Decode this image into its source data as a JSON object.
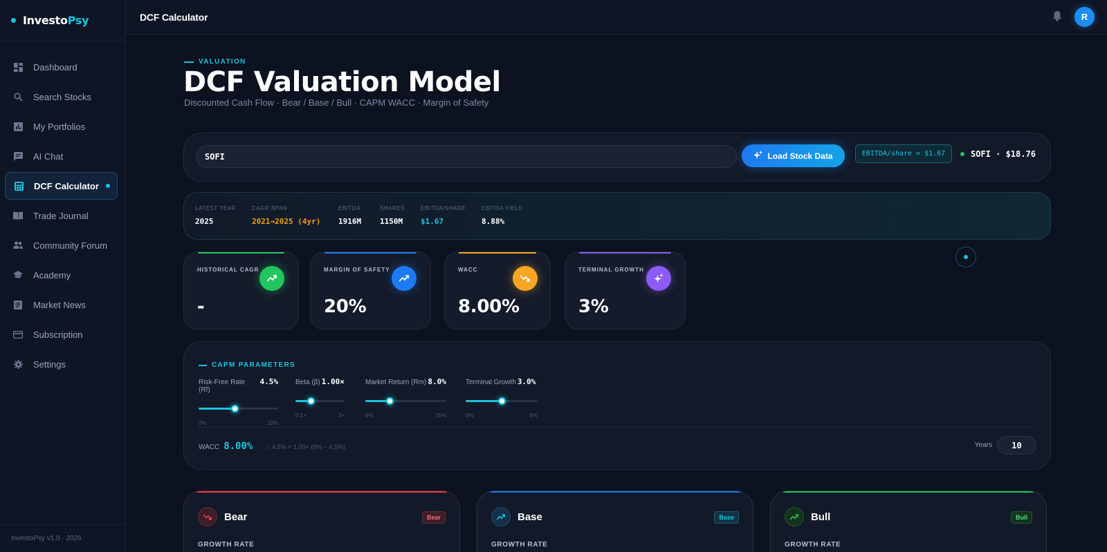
{
  "app": {
    "logo_part1": "Investo",
    "logo_part2": "Psy",
    "version": "InvestoPsy v1.0 · 2026",
    "accent": "#19c3e0"
  },
  "sidebar": {
    "items": [
      {
        "label": "Dashboard",
        "icon": "dashboard-icon"
      },
      {
        "label": "Search Stocks",
        "icon": "search-icon"
      },
      {
        "label": "My Portfolios",
        "icon": "chart-icon"
      },
      {
        "label": "AI Chat",
        "icon": "chat-icon"
      },
      {
        "label": "DCF Calculator",
        "icon": "calculator-icon",
        "active": true
      },
      {
        "label": "Trade Journal",
        "icon": "book-icon"
      },
      {
        "label": "Community Forum",
        "icon": "people-icon"
      },
      {
        "label": "Academy",
        "icon": "school-icon"
      },
      {
        "label": "Market News",
        "icon": "news-icon"
      },
      {
        "label": "Subscription",
        "icon": "card-icon"
      },
      {
        "label": "Settings",
        "icon": "gear-icon"
      }
    ]
  },
  "topbar": {
    "title": "DCF Calculator",
    "avatar_initial": "R"
  },
  "page": {
    "eyebrow": "VALUATION",
    "title": "DCF Valuation Model",
    "subtitle": "Discounted Cash Flow · Bear / Base / Bull · CAPM WACC · Margin of Safety"
  },
  "search": {
    "value": "SOFI",
    "load_label": "Load Stock Data",
    "ebitda_chip": "EBITDA/share = $1.67",
    "ticker_status": "SOFI · $18.76"
  },
  "stats": [
    {
      "label": "LATEST YEAR",
      "value": "2025",
      "color": "#ffffff"
    },
    {
      "label": "CAGR SPAN",
      "value": "2021→2025 (4yr)",
      "color": "#f59e0b"
    },
    {
      "label": "EBITDA",
      "value": "1916M",
      "color": "#ffffff"
    },
    {
      "label": "SHARES",
      "value": "1150M",
      "color": "#ffffff"
    },
    {
      "label": "EBITDA/SHARE",
      "value": "$1.67",
      "color": "#19c3e0"
    },
    {
      "label": "EBITDA YIELD",
      "value": "8.88%",
      "color": "#ffffff"
    }
  ],
  "kpis": [
    {
      "label": "HISTORICAL CAGR",
      "value": "-",
      "color": "#22c55e",
      "icon": "trending-up-icon"
    },
    {
      "label": "MARGIN OF SAFETY",
      "value": "20%",
      "color": "#1e7af2",
      "icon": "trending-up-icon"
    },
    {
      "label": "WACC",
      "value": "8.00%",
      "color": "#f5a623",
      "icon": "trending-down-icon"
    },
    {
      "label": "TERMINAL GROWTH",
      "value": "3%",
      "color": "#8b5cf6",
      "icon": "sparkle-icon"
    }
  ],
  "capm": {
    "title": "CAPM PARAMETERS",
    "sliders": [
      {
        "label": "Risk-Free Rate (Rf)",
        "value": "4.5%",
        "min": "0%",
        "max": "10%",
        "fraction": 0.45
      },
      {
        "label": "Beta (β)",
        "value": "1.00×",
        "min": "0.1×",
        "max": "3×",
        "fraction": 0.31
      },
      {
        "label": "Market Return (Rm)",
        "value": "8.0%",
        "min": "5%",
        "max": "15%",
        "fraction": 0.3
      },
      {
        "label": "Terminal Growth",
        "value": "3.0%",
        "min": "0%",
        "max": "6%",
        "fraction": 0.5
      }
    ],
    "wacc_label": "WACC",
    "wacc_value": "8.00%",
    "wacc_formula": "= 4.5% + 1.00× (8% − 4.5%)",
    "years_label": "Years",
    "years_value": "10"
  },
  "scenarios": [
    {
      "name": "Bear",
      "badge": "Bear",
      "growth_label": "GROWTH RATE",
      "color": "#ef4444",
      "icon": "trending-down-icon"
    },
    {
      "name": "Base",
      "badge": "Base",
      "growth_label": "GROWTH RATE",
      "color": "#19c3e0",
      "icon": "trending-up-icon"
    },
    {
      "name": "Bull",
      "badge": "Bull",
      "growth_label": "GROWTH RATE",
      "color": "#22c55e",
      "icon": "trending-up-icon"
    }
  ]
}
